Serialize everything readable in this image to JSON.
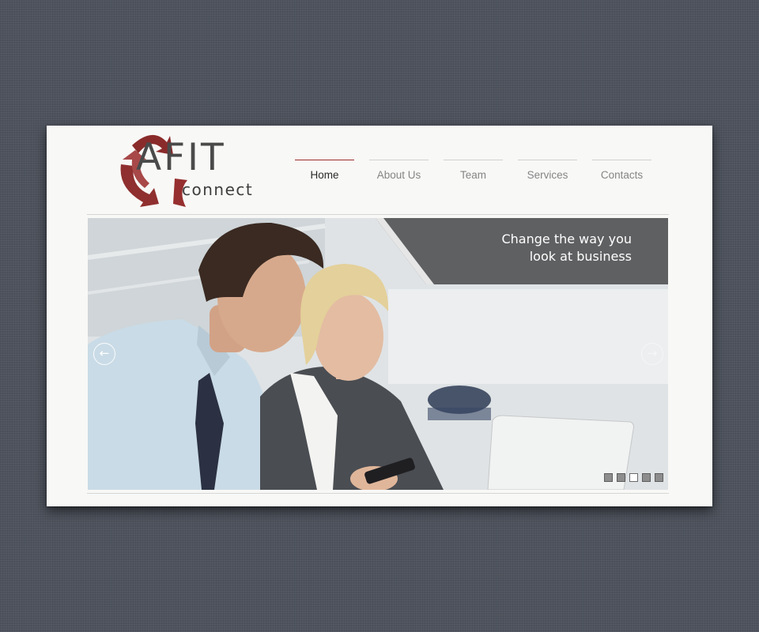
{
  "logo": {
    "primary": "AFIT",
    "secondary": "connect"
  },
  "nav": [
    {
      "label": "Home",
      "active": true
    },
    {
      "label": "About Us",
      "active": false
    },
    {
      "label": "Team",
      "active": false
    },
    {
      "label": "Services",
      "active": false
    },
    {
      "label": "Contacts",
      "active": false
    }
  ],
  "slider": {
    "caption_line1": "Change the way you",
    "caption_line2": "look at business",
    "prev_arrow_glyph": "←",
    "next_arrow_glyph": "→",
    "prev_icon": "arrow-left-circle-icon",
    "next_icon": "arrow-right-circle-icon",
    "slide_count": 5,
    "active_slide": 3
  },
  "colors": {
    "background": "#4e535d",
    "card": "#f8f8f6",
    "accent_red": "#9b2d2d",
    "nav_active_text": "#2a2a2a",
    "nav_text": "#858585",
    "caption_band": "#5f6062"
  }
}
